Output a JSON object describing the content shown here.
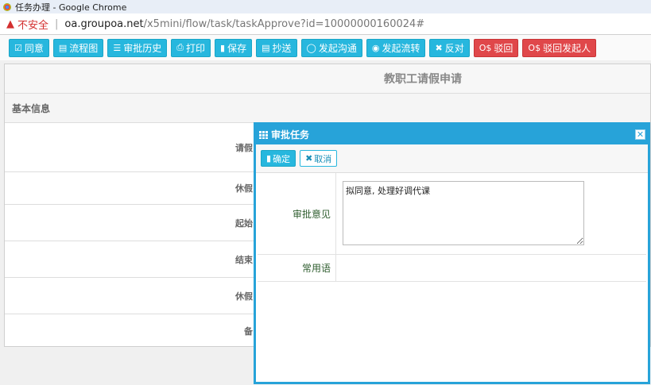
{
  "window": {
    "title": "任务办理 - Google Chrome"
  },
  "address": {
    "insecure_label": "不安全",
    "separator": "|",
    "host": "oa.groupoa.net",
    "path": "/x5mini/flow/task/taskApprove?id=10000000160024#"
  },
  "toolbar": {
    "buttons": [
      {
        "icon": "☑",
        "label": "同意"
      },
      {
        "icon": "▤",
        "label": "流程图"
      },
      {
        "icon": "☰",
        "label": "审批历史"
      },
      {
        "icon": "⎙",
        "label": "打印"
      },
      {
        "icon": "▮",
        "label": "保存"
      },
      {
        "icon": "▤",
        "label": "抄送"
      },
      {
        "icon": "◯",
        "label": "发起沟通"
      },
      {
        "icon": "◉",
        "label": "发起流转"
      },
      {
        "icon": "✖",
        "label": "反对"
      },
      {
        "icon": "Ο$",
        "label": "驳回"
      },
      {
        "icon": "Ο$",
        "label": "驳回发起人"
      }
    ]
  },
  "form": {
    "title": "教职工请假申请",
    "section": "基本信息",
    "rows": [
      "请假",
      "休假",
      "起始",
      "结束",
      "休假",
      "备"
    ]
  },
  "dialog": {
    "title": "审批任务",
    "close": "✕",
    "ok_label": "确定",
    "cancel_label": "取消",
    "opinion_label": "审批意见",
    "opinion_value": "拟同意, 处理好调代课",
    "phrases_label": "常用语"
  },
  "colors": {
    "accent": "#27b7de",
    "danger": "#e0474a",
    "dialog_border": "#27a3d9"
  }
}
